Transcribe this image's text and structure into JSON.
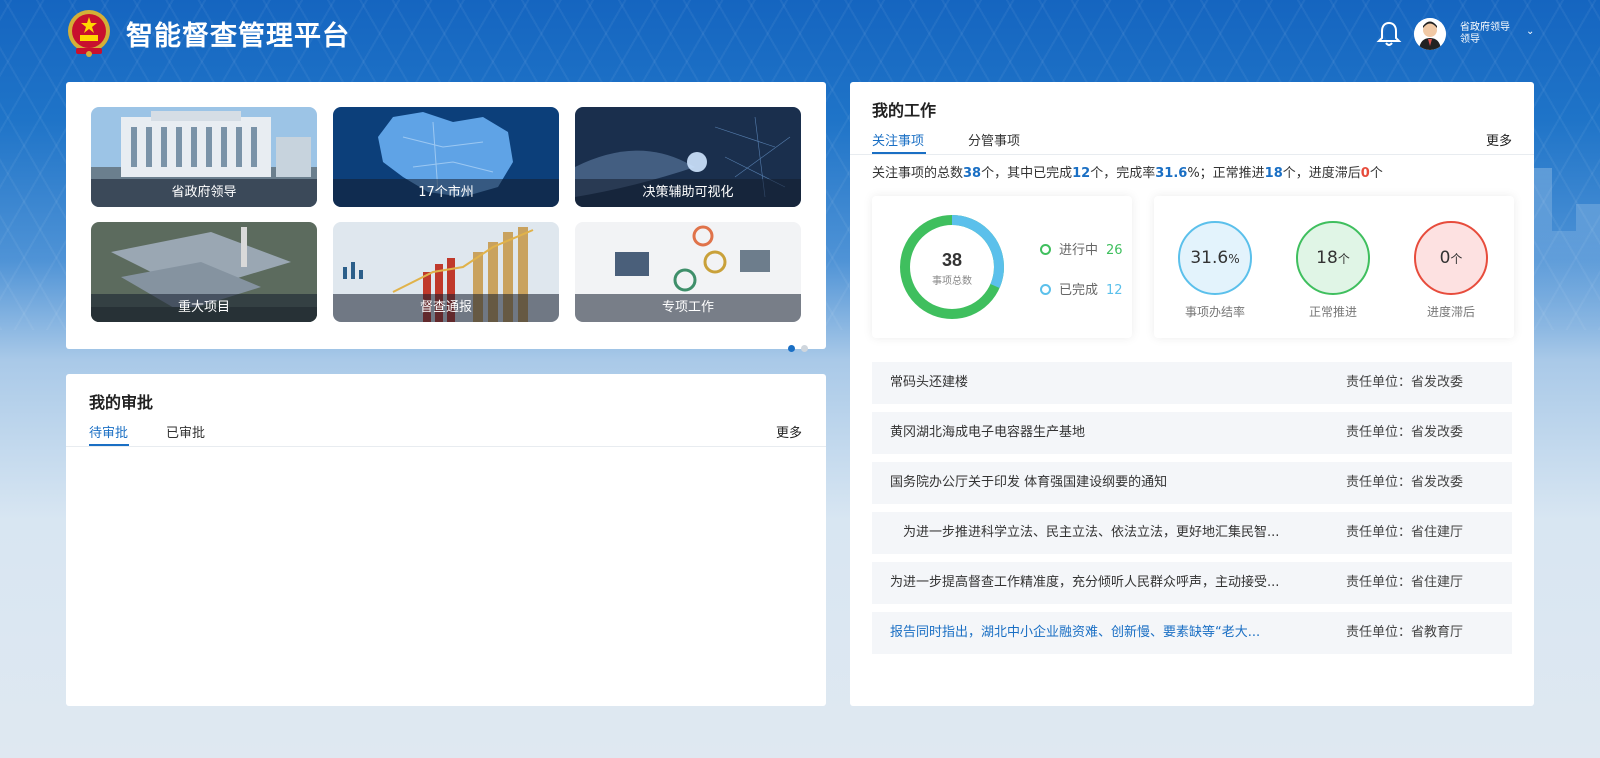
{
  "app": {
    "title": "智能督查管理平台"
  },
  "user": {
    "line1": "省政府领导",
    "line2": "领导"
  },
  "colors": {
    "primary": "#1a6fc4",
    "green": "#3fbf5e",
    "lightBlue": "#5bc0eb",
    "red": "#e74c3c"
  },
  "quick_tiles": [
    {
      "label": "省政府领导"
    },
    {
      "label": "17个市州"
    },
    {
      "label": "决策辅助可视化"
    },
    {
      "label": "重大项目"
    },
    {
      "label": "督查通报"
    },
    {
      "label": "专项工作"
    }
  ],
  "approval": {
    "title": "我的审批",
    "tabs": [
      "待审批",
      "已审批"
    ],
    "more": "更多"
  },
  "work": {
    "title": "我的工作",
    "tabs": [
      "关注事项",
      "分管事项"
    ],
    "more": "更多",
    "summary": {
      "t1": "关注事项的总数",
      "total": "38",
      "t2": "个，其中已完成",
      "done": "12",
      "t3": "个，完成率",
      "rate": "31.6",
      "t4": "%；正常推进",
      "normal": "18",
      "t5": "个，进度滞后",
      "late": "0",
      "t6": "个"
    },
    "donut": {
      "total": "38",
      "total_label": "事项总数",
      "in_progress_label": "进行中",
      "in_progress": 26,
      "done_label": "已完成",
      "done": 12
    },
    "metrics": [
      {
        "value": "31.6",
        "unit": "%",
        "label": "事项办结率"
      },
      {
        "value": "18",
        "unit": "个",
        "label": "正常推进"
      },
      {
        "value": "0",
        "unit": "个",
        "label": "进度滞后"
      }
    ],
    "items": [
      {
        "name": "常码头还建楼",
        "unit": "责任单位：省发改委"
      },
      {
        "name": "黄冈湖北海成电子电容器生产基地",
        "unit": "责任单位：省发改委"
      },
      {
        "name": "国务院办公厅关于印发 体育强国建设纲要的通知",
        "unit": "责任单位：省发改委"
      },
      {
        "name": "　为进一步推进科学立法、民主立法、依法立法，更好地汇集民智...",
        "unit": "责任单位：省住建厅"
      },
      {
        "name": "为进一步提高督查工作精准度，充分倾听人民群众呼声，主动接受...",
        "unit": "责任单位：省住建厅"
      },
      {
        "name": "报告同时指出，湖北中小企业融资难、创新慢、要素缺等“老大...",
        "unit": "责任单位：省教育厅"
      }
    ]
  }
}
